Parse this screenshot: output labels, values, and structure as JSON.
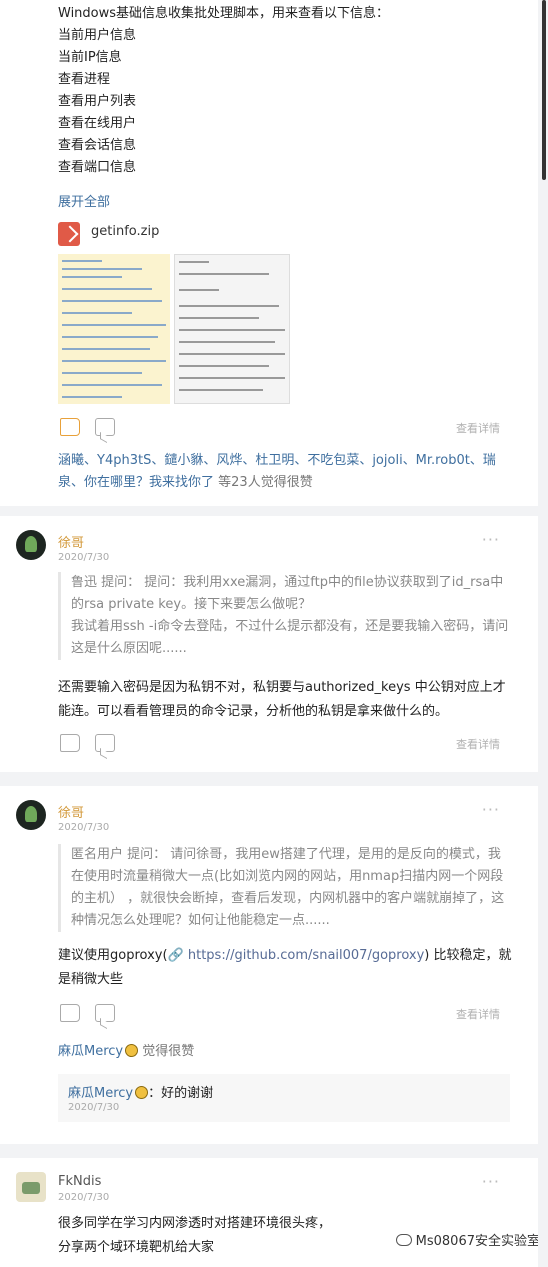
{
  "post": {
    "lines": [
      "Windows基础信息收集批处理脚本，用来查看以下信息：",
      "当前用户信息",
      "当前IP信息",
      "查看进程",
      "查看用户列表",
      "查看在线用户",
      "查看会话信息",
      "查看端口信息"
    ],
    "expand_label": "展开全部",
    "attachment_name": "getinfo.zip",
    "details_label": "查看详情",
    "likers_names": "涵曦、Y4ph3tS、鑓小貅、风烨、杜卫明、不吃包菜、jojoli、Mr.rob0t、瑞泉、你在哪里？我来找你了",
    "likers_count": " 等23人觉得很赞"
  },
  "comments": [
    {
      "username": "徐哥",
      "date": "2020/7/30",
      "more": "···",
      "quote_author": "鲁迅",
      "quote_text": "鲁迅  提问：  提问：我利用xxe漏洞，通过ftp中的file协议获取到了id_rsa中的rsa private key。接下来要怎么做呢？",
      "quote_text2": "我试着用ssh -i命令去登陆，不过什么提示都没有，还是要我输入密码，请问这是什么原因呢......",
      "reply": "还需要输入密码是因为私钥不对，私钥要与authorized_keys 中公钥对应上才能连。可以看看管理员的命令记录，分析他的私钥是拿来做什么的。",
      "details_label": "查看详情"
    },
    {
      "username": "徐哥",
      "date": "2020/7/30",
      "more": "···",
      "quote_text": "匿名用户  提问：  请问徐哥，我用ew搭建了代理，是用的是反向的模式，我在使用时流量稍微大一点(比如浏览内网的网站，用nmap扫描内网一个网段的主机）  ，就很快会断掉，查看后发现，内网机器中的客户端就崩掉了，这种情况怎么处理呢？如何让他能稳定一点......",
      "reply_prefix": "建议使用goproxy(",
      "reply_url": "https://github.com/snail007/goproxy",
      "reply_suffix": ") 比较稳定，就是稍微大些",
      "details_label": "查看详情",
      "liked_by_name": "麻瓜Mercy",
      "liked_by_suffix": " 觉得很赞",
      "sub_reply_author": "麻瓜Mercy",
      "sub_reply_text": "：好的谢谢",
      "sub_reply_date": "2020/7/30"
    },
    {
      "username": "FkNdis",
      "date": "2020/7/30",
      "more": "···",
      "line1": "很多同学在学习内网渗透时对搭建环境很头疼，",
      "line2": "分享两个域环境靶机给大家"
    }
  ],
  "watermark": "Ms08067安全实验室",
  "colors": {
    "link": "#3f6f9f",
    "username": "#d39a3c",
    "accent_like": "#e8a13a",
    "background": "#f2f3f5"
  },
  "icons": [
    "zip-file-icon",
    "like-icon",
    "comment-icon",
    "link-icon",
    "emoji-icon",
    "wechat-icon"
  ]
}
